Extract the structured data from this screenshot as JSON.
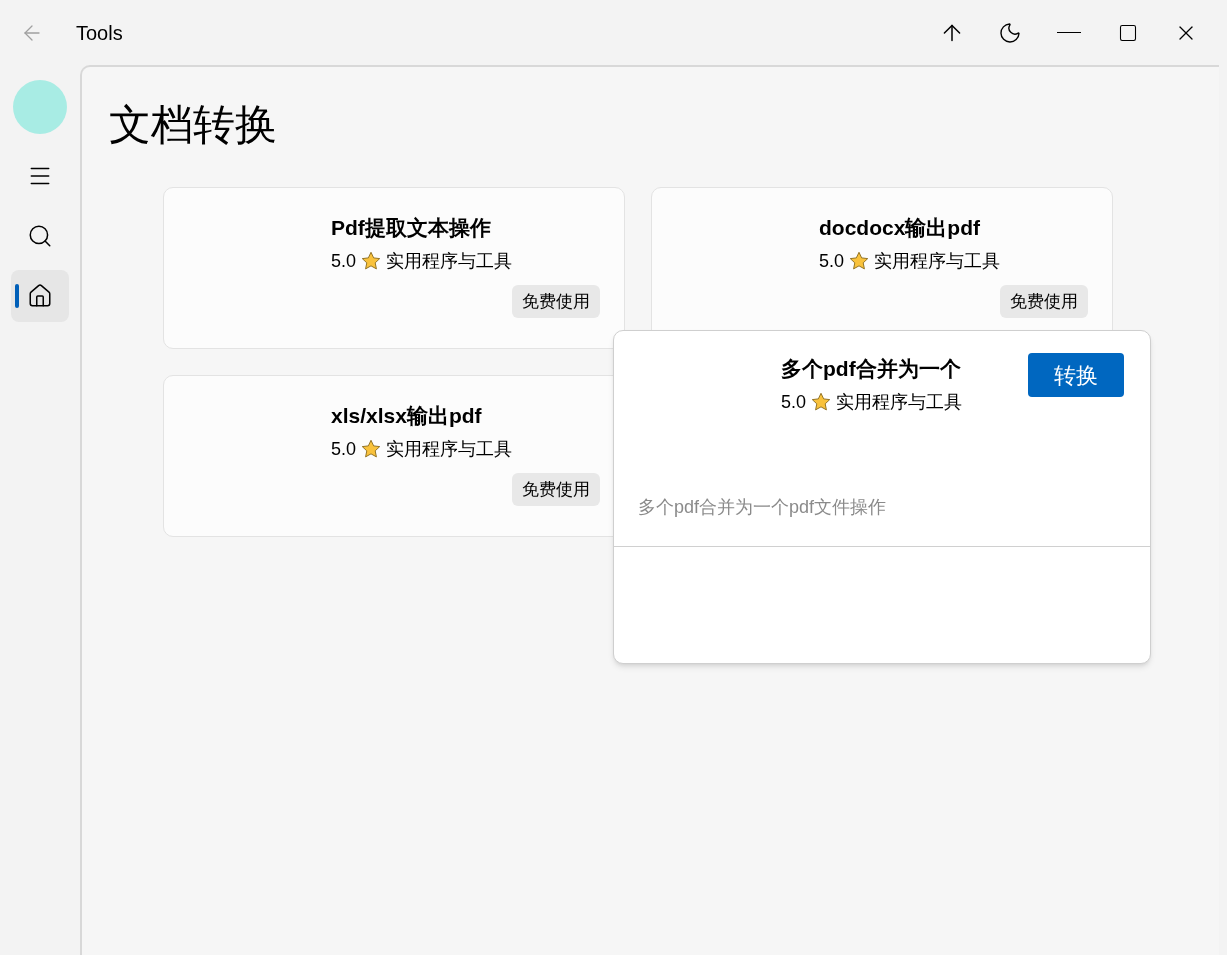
{
  "window": {
    "title": "Tools"
  },
  "sidebar": {
    "items": [
      {
        "kind": "menu",
        "selected": false
      },
      {
        "kind": "search",
        "selected": false
      },
      {
        "kind": "home",
        "selected": true
      }
    ]
  },
  "page": {
    "title": "文档转换"
  },
  "cards": [
    {
      "title": "Pdf提取文本操作",
      "rating": "5.0",
      "category": "实用程序与工具",
      "action": "免费使用"
    },
    {
      "title": "docdocx输出pdf",
      "rating": "5.0",
      "category": "实用程序与工具",
      "action": "免费使用"
    },
    {
      "title": "xls/xlsx输出pdf",
      "rating": "5.0",
      "category": "实用程序与工具",
      "action": "免费使用"
    }
  ],
  "popup": {
    "title": "多个pdf合并为一个",
    "rating": "5.0",
    "category": "实用程序与工具",
    "action": "转换",
    "description": "多个pdf合并为一个pdf文件操作"
  }
}
